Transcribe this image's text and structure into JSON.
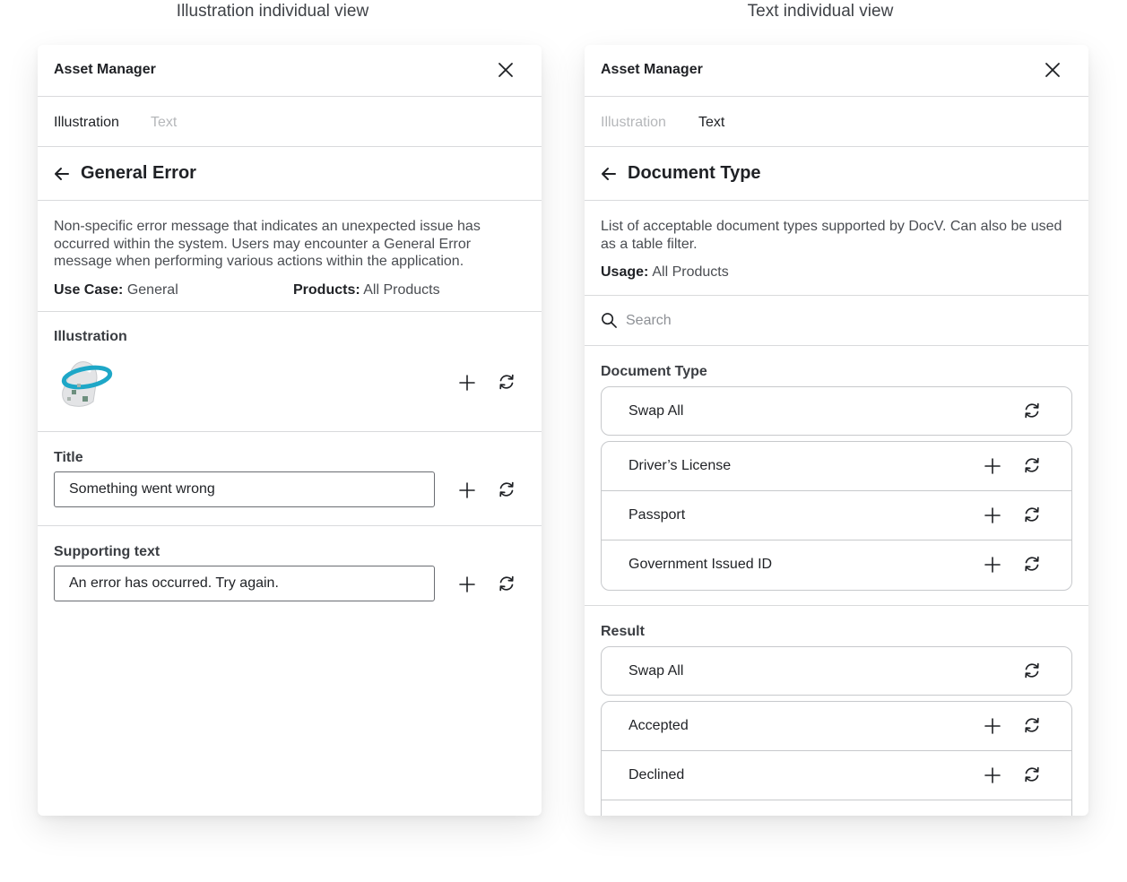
{
  "left_view": {
    "caption": "Illustration individual view",
    "app_title": "Asset Manager",
    "tabs": [
      {
        "label": "Illustration",
        "active": true
      },
      {
        "label": "Text",
        "active": false
      }
    ],
    "page_title": "General Error",
    "description": "Non-specific error message that indicates an unexpected issue has occurred within the system. Users may encounter a General Error message when performing various actions within the application.",
    "use_case_label": "Use Case:",
    "use_case_value": "General",
    "products_label": "Products:",
    "products_value": "All Products",
    "illustration_label": "Illustration",
    "title_label": "Title",
    "title_value": "Something went wrong",
    "supporting_label": "Supporting text",
    "supporting_value": "An error has occurred. Try again."
  },
  "right_view": {
    "caption": "Text individual view",
    "app_title": "Asset Manager",
    "tabs": [
      {
        "label": "Illustration",
        "active": false
      },
      {
        "label": "Text",
        "active": true
      }
    ],
    "page_title": "Document Type",
    "description": "List of acceptable document types supported by DocV. Can also be used as a table filter.",
    "usage_label": "Usage:",
    "usage_value": "All Products",
    "search_placeholder": "Search",
    "groups": [
      {
        "label": "Document Type",
        "swap_all": "Swap All",
        "items": [
          "Driver’s License",
          "Passport",
          "Government Issued ID"
        ]
      },
      {
        "label": "Result",
        "swap_all": "Swap All",
        "items": [
          "Accepted",
          "Declined"
        ]
      }
    ]
  },
  "colors": {
    "text_primary": "#1f2125",
    "text_muted": "#b5b7ba",
    "divider": "#d9dadc",
    "illustration_ring": "#1ea7c7"
  },
  "icons": [
    "close-icon",
    "back-arrow-icon",
    "plus-icon",
    "swap-icon",
    "search-icon"
  ]
}
